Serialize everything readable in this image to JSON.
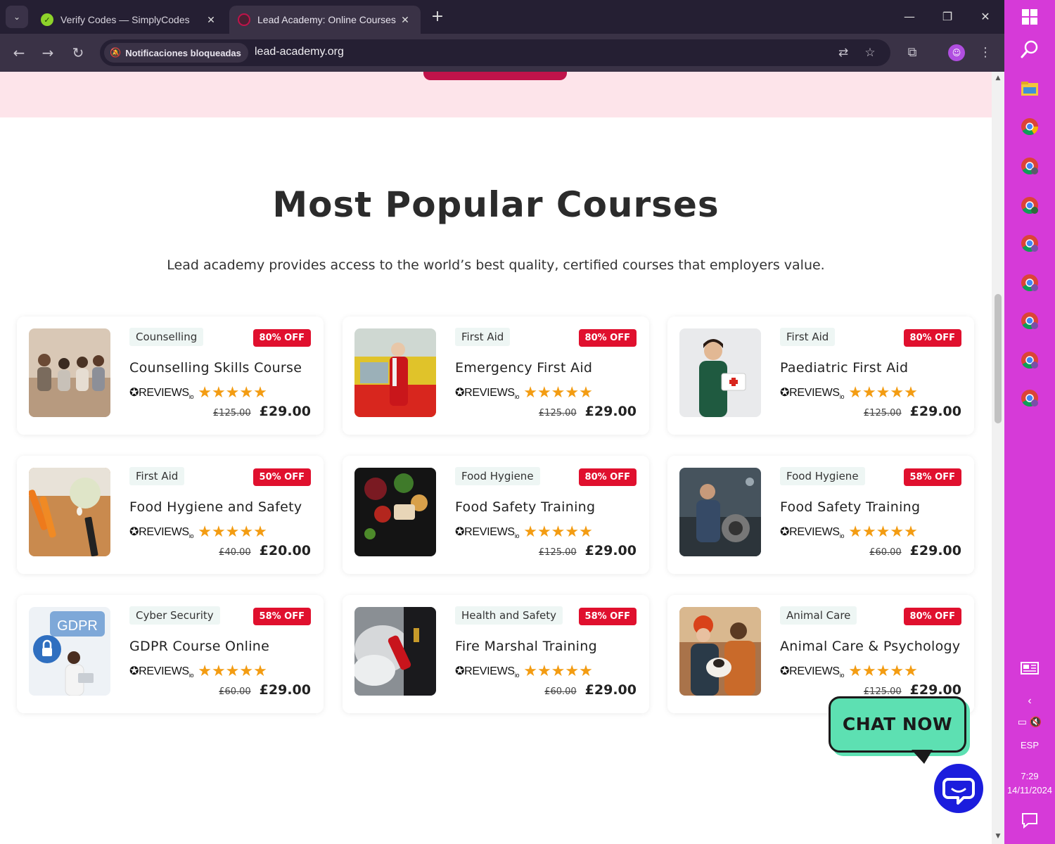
{
  "browser": {
    "tabs": [
      {
        "title": "Verify Codes — SimplyCodes",
        "active": false
      },
      {
        "title": "Lead Academy: Online Courses",
        "active": true
      }
    ],
    "site_chip": "Notificaciones bloqueadas",
    "url": "lead-academy.org"
  },
  "page": {
    "section_title": "Most Popular Courses",
    "section_subtitle": "Lead academy provides access to the world’s best quality, certified courses that employers value.",
    "reviews_brand": "REVIEWS",
    "reviews_suffix": "io",
    "stars": "★★★★★",
    "courses": [
      {
        "category": "Counselling",
        "discount": "80% OFF",
        "title": "Counselling Skills Course",
        "old_price": "£125.00",
        "price": "£29.00"
      },
      {
        "category": "First Aid",
        "discount": "80% OFF",
        "title": "Emergency First Aid",
        "old_price": "£125.00",
        "price": "£29.00"
      },
      {
        "category": "First Aid",
        "discount": "80% OFF",
        "title": "Paediatric First Aid",
        "old_price": "£125.00",
        "price": "£29.00"
      },
      {
        "category": "First Aid",
        "discount": "50% OFF",
        "title": "Food Hygiene and Safety",
        "old_price": "£40.00",
        "price": "£20.00"
      },
      {
        "category": "Food Hygiene",
        "discount": "80% OFF",
        "title": "Food Safety Training",
        "old_price": "£125.00",
        "price": "£29.00"
      },
      {
        "category": "Food Hygiene",
        "discount": "58% OFF",
        "title": "Food Safety Training",
        "old_price": "£60.00",
        "price": "£29.00"
      },
      {
        "category": "Cyber Security",
        "discount": "58% OFF",
        "title": "GDPR Course Online",
        "old_price": "£60.00",
        "price": "£29.00",
        "thumb_label": "GDPR"
      },
      {
        "category": "Health and Safety",
        "discount": "58% OFF",
        "title": "Fire Marshal Training",
        "old_price": "£60.00",
        "price": "£29.00"
      },
      {
        "category": "Animal Care",
        "discount": "80% OFF",
        "title": "Animal Care & Psychology",
        "old_price": "£125.00",
        "price": "£29.00"
      }
    ],
    "chat_label": "CHAT NOW"
  },
  "taskbar": {
    "language": "ESP",
    "time": "7:29",
    "date": "14/11/2024"
  },
  "colors": {
    "brand_red": "#c0134a",
    "badge_red": "#e0102e",
    "pink_band": "#fde4ea",
    "chat_green": "#5de0b2",
    "chat_blue": "#1b1ddd",
    "taskbar": "#d63ad8",
    "star": "#f39c12"
  }
}
